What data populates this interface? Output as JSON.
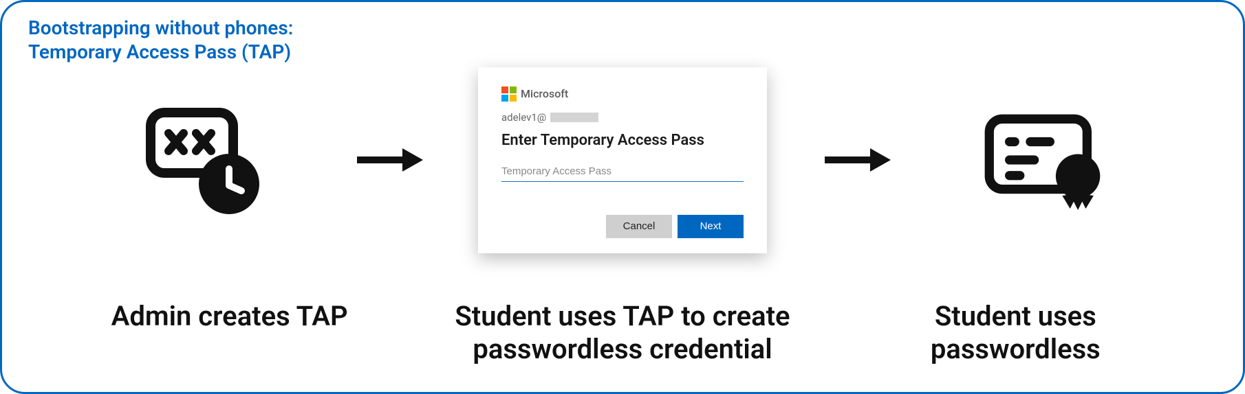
{
  "title": {
    "line1": "Bootstrapping without phones:",
    "line2": "Temporary Access Pass (TAP)"
  },
  "steps": {
    "step1_caption": "Admin creates TAP",
    "step2_caption": "Student uses TAP to create passwordless credential",
    "step3_caption": "Student uses passwordless"
  },
  "dialog": {
    "brand": "Microsoft",
    "email_prefix": "adelev1@",
    "heading": "Enter Temporary Access Pass",
    "placeholder": "Temporary Access Pass",
    "cancel_label": "Cancel",
    "next_label": "Next"
  }
}
